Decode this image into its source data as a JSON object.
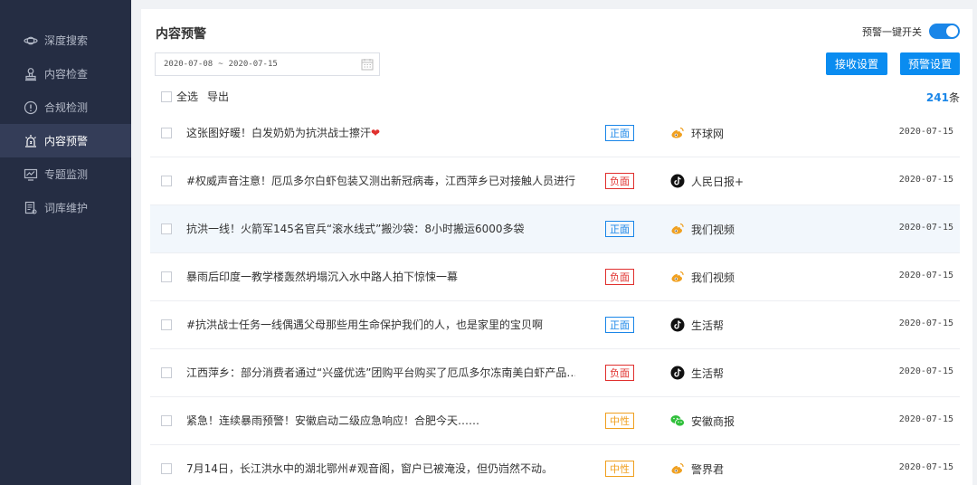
{
  "nav": [
    {
      "label": "深度搜索",
      "icon": "planet-icon"
    },
    {
      "label": "内容检查",
      "icon": "stamp-icon"
    },
    {
      "label": "合规检测",
      "icon": "shield-alert-icon"
    },
    {
      "label": "内容预警",
      "icon": "alarm-light-icon",
      "active": true
    },
    {
      "label": "专题监测",
      "icon": "monitor-chart-icon"
    },
    {
      "label": "词库维护",
      "icon": "dictionary-icon"
    }
  ],
  "header": {
    "title": "内容预警",
    "toggle_label": "预警一键开关",
    "toggle_on": true
  },
  "filters": {
    "date_start": "2020-07-08",
    "date_sep": "~",
    "date_end": "2020-07-15",
    "receive_btn": "接收设置",
    "warn_btn": "预警设置",
    "select_all": "全选",
    "export": "导出",
    "count_num": "241",
    "count_unit": "条"
  },
  "rows": [
    {
      "title": "这张图好暖！白发奶奶为抗洪战士擦汗",
      "heart": "❤",
      "sentiment": "正面",
      "sentiment_type": "pos",
      "source": "环球网",
      "source_icon": "weibo-icon",
      "date": "2020-07-15"
    },
    {
      "title": "#权威声音注意！厄瓜多尔白虾包装又测出新冠病毒，江西萍乡已对接触人员进行…",
      "heart": "",
      "sentiment": "负面",
      "sentiment_type": "neg",
      "source": "人民日报+",
      "source_icon": "tiktok-icon",
      "date": "2020-07-15"
    },
    {
      "title": "抗洪一线！火箭军145名官兵“滚水线式”搬沙袋：8小时搬运6000多袋",
      "heart": "",
      "sentiment": "正面",
      "sentiment_type": "pos",
      "source": "我们视频",
      "source_icon": "weibo-icon",
      "date": "2020-07-15"
    },
    {
      "title": "暴雨后印度一教学楼轰然坍塌沉入水中路人拍下惊悚一幕",
      "heart": "",
      "sentiment": "负面",
      "sentiment_type": "neg",
      "source": "我们视频",
      "source_icon": "weibo-icon",
      "date": "2020-07-15"
    },
    {
      "title": "#抗洪战士任务一线偶遇父母那些用生命保护我们的人，也是家里的宝贝啊",
      "heart": "",
      "sentiment": "正面",
      "sentiment_type": "pos",
      "source": "生活帮",
      "source_icon": "tiktok-icon",
      "date": "2020-07-15"
    },
    {
      "title": "江西萍乡：部分消费者通过“兴盛优选”团购平台购买了厄瓜多尔冻南美白虾产品…",
      "heart": "",
      "sentiment": "负面",
      "sentiment_type": "neg",
      "source": "生活帮",
      "source_icon": "tiktok-icon",
      "date": "2020-07-15"
    },
    {
      "title": "紧急！连续暴雨预警！安徽启动二级应急响应！合肥今天……",
      "heart": "",
      "sentiment": "中性",
      "sentiment_type": "neu",
      "source": "安徽商报",
      "source_icon": "wechat-icon",
      "date": "2020-07-15"
    },
    {
      "title": "7月14日，长江洪水中的湖北鄂州#观音阁，窗户已被淹没，但仍岿然不动。",
      "heart": "",
      "sentiment": "中性",
      "sentiment_type": "neu",
      "source": "警界君",
      "source_icon": "weibo-icon",
      "date": "2020-07-15"
    }
  ],
  "colors": {
    "sidebar": "#252d43",
    "accent": "#0a8cf0",
    "positive": "#1a86e8",
    "negative": "#e0302e",
    "neutral": "#f0a020"
  }
}
